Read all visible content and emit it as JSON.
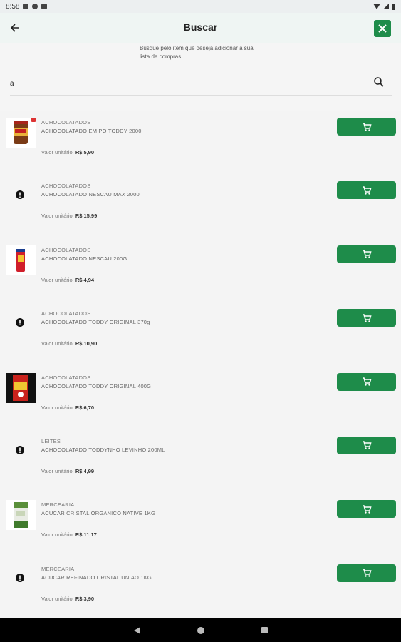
{
  "status_bar": {
    "time": "8:58"
  },
  "header": {
    "title": "Buscar"
  },
  "subtitle": "Busque pelo item que deseja adicionar a sua lista de compras.",
  "search": {
    "value": "a",
    "placeholder": ""
  },
  "price_label": "Valor unitário:",
  "colors": {
    "accent": "#1e8c4a",
    "app_bar": "#eff5f3",
    "background": "#f4f4f4"
  },
  "products": [
    {
      "category": "ACHOCOLATADOS",
      "name": "ACHOCOLATADO EM PO TODDY 2000",
      "price": "R$ 5,90",
      "image": "toddy-pot-image"
    },
    {
      "category": "ACHOCOLATADOS",
      "name": "ACHOCOLATADO NESCAU MAX 2000",
      "price": "R$ 15,99",
      "image": "none"
    },
    {
      "category": "ACHOCOLATADOS",
      "name": "ACHOCOLATADO NESCAU 200G",
      "price": "R$ 4,94",
      "image": "nescau-image"
    },
    {
      "category": "ACHOCOLATADOS",
      "name": "ACHOCOLATADO TODDY ORIGINAL 370g",
      "price": "R$ 10,90",
      "image": "none"
    },
    {
      "category": "ACHOCOLATADOS",
      "name": "ACHOCOLATADO TODDY ORIGINAL 400G",
      "price": "R$ 6,70",
      "image": "toddy-box-image"
    },
    {
      "category": "LEITES",
      "name": "ACHOCOLATADO TODDYNHO LEVINHO 200ML",
      "price": "R$ 4,99",
      "image": "none"
    },
    {
      "category": "MERCEARIA",
      "name": "ACUCAR CRISTAL ORGANICO NATIVE 1KG",
      "price": "R$ 11,17",
      "image": "sugar-pack-image"
    },
    {
      "category": "MERCEARIA",
      "name": "ACUCAR REFINADO CRISTAL UNIAO 1KG",
      "price": "R$ 3,90",
      "image": "none"
    }
  ]
}
